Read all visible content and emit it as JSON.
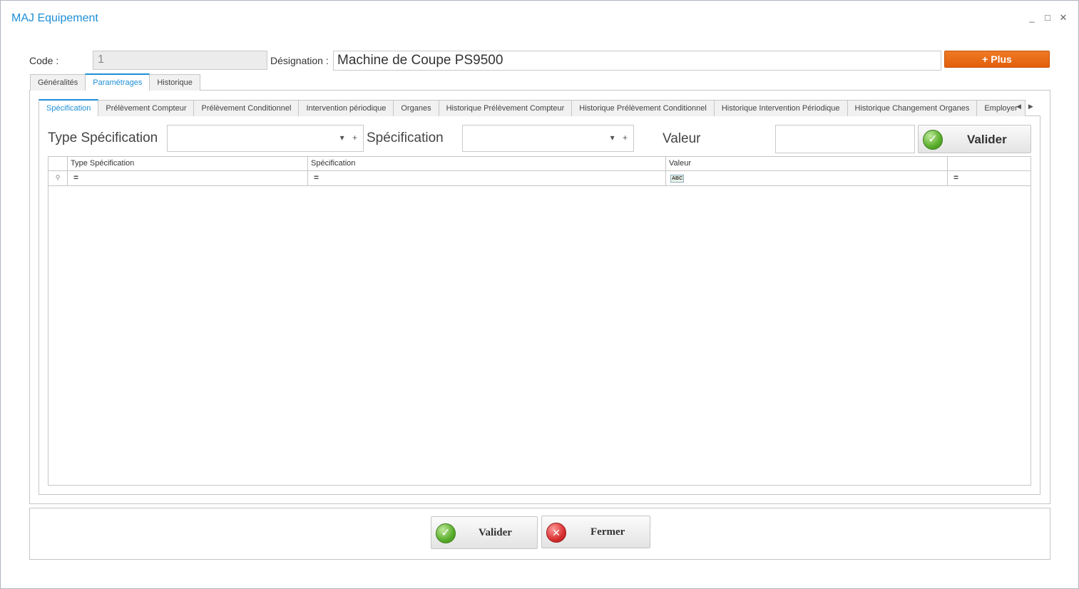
{
  "window": {
    "title": "MAJ Equipement",
    "controls": [
      "_",
      "□",
      "✕"
    ]
  },
  "header": {
    "code_label": "Code :",
    "code_value": "1",
    "designation_label": "Désignation :",
    "designation_value": "Machine de Coupe PS9500",
    "plus_button": "+ Plus"
  },
  "main_tabs": [
    {
      "label": "Généralités",
      "active": false
    },
    {
      "label": "Paramétrages",
      "active": true
    },
    {
      "label": "Historique",
      "active": false
    }
  ],
  "sub_tabs": [
    {
      "label": "Spécification",
      "active": true
    },
    {
      "label": "Prélèvement Compteur",
      "active": false
    },
    {
      "label": "Prélèvement Conditionnel",
      "active": false
    },
    {
      "label": "Intervention périodique",
      "active": false
    },
    {
      "label": "Organes",
      "active": false
    },
    {
      "label": "Historique Prélèvement Compteur",
      "active": false
    },
    {
      "label": "Historique Prélèvement Conditionnel",
      "active": false
    },
    {
      "label": "Historique Intervention Périodique",
      "active": false
    },
    {
      "label": "Historique Changement Organes",
      "active": false
    },
    {
      "label": "Employer",
      "active": false
    }
  ],
  "filters": {
    "type_spec_label": "Type Spécification",
    "type_spec_value": "",
    "spec_label": "Spécification",
    "spec_value": "",
    "valeur_label": "Valeur",
    "valeur_value": "",
    "valider_label": "Valider"
  },
  "grid": {
    "columns": [
      "Type Spécification",
      "Spécification",
      "Valeur",
      ""
    ],
    "filter_row": [
      "=",
      "=",
      "ABC",
      "="
    ],
    "rows": []
  },
  "footer": {
    "valider_label": "Valider",
    "fermer_label": "Fermer"
  },
  "colors": {
    "accent": "#1e8fd6",
    "plus_button": "#e8690f"
  }
}
